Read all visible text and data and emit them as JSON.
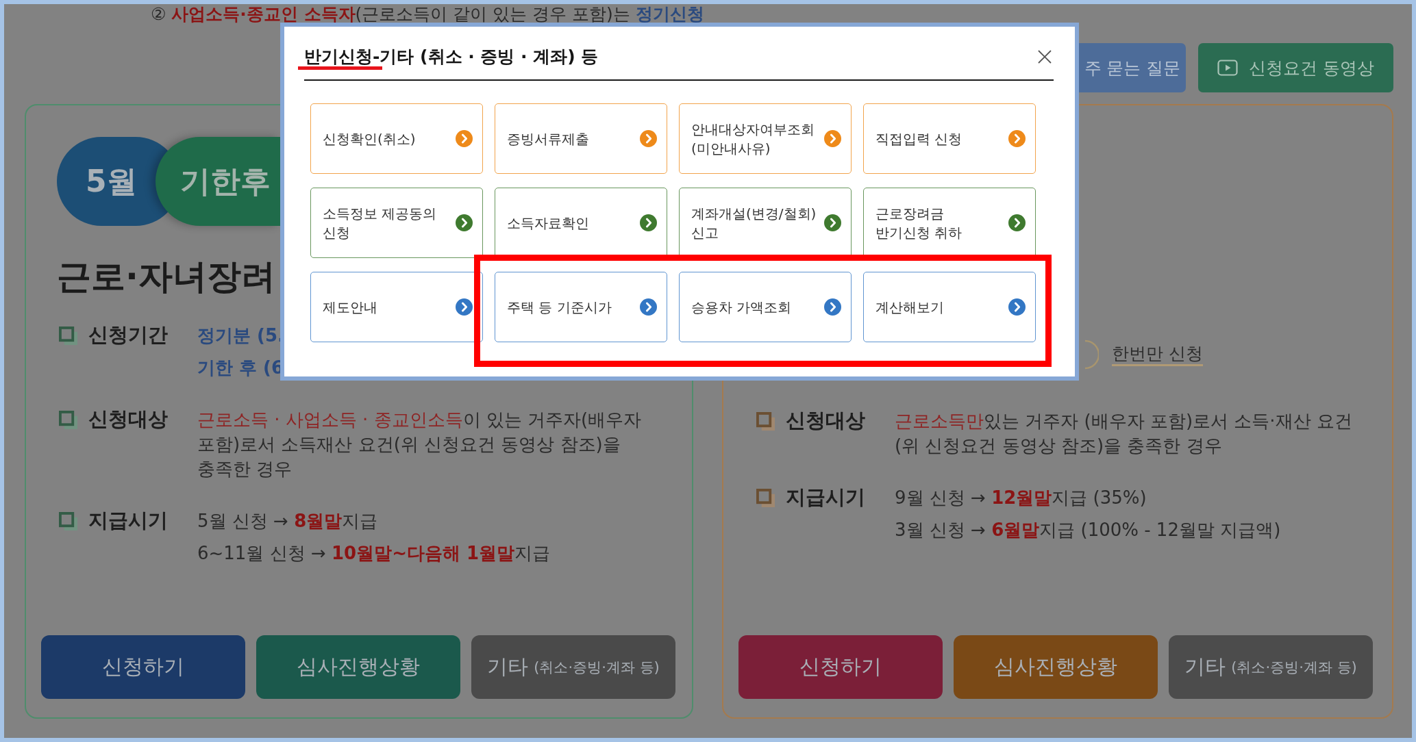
{
  "notice": {
    "segments": [
      {
        "text": "② ",
        "kind": "plain"
      },
      {
        "text": "사업소득·종교인 소득자",
        "kind": "strong"
      },
      {
        "text": "(근로소득이 같이 있는 경우 포함)는 ",
        "kind": "plain"
      },
      {
        "text": "정기신청",
        "kind": "accent"
      }
    ]
  },
  "top_buttons": [
    {
      "label": "주 묻는 질문",
      "kind": "plain",
      "color": "#4d6c99"
    },
    {
      "label": "신청요건 동영상",
      "kind": "video",
      "color": "#2b6c52"
    }
  ],
  "cards": [
    {
      "color": "#4f8d6c",
      "badges": [
        {
          "label": "5월",
          "color": "#1c4e75"
        },
        {
          "label": "기한후",
          "color": "#1f6b4a"
        }
      ],
      "heading": "근로·자녀장려",
      "rows": [
        {
          "label": "신청기간",
          "lines": [
            [
              {
                "text": "정기분 (5.",
                "kind": "accent"
              }
            ],
            [
              {
                "text": "기한 후 (6",
                "kind": "accent"
              }
            ]
          ]
        },
        {
          "label": "신청대상",
          "lines": [
            [
              {
                "text": "근로소득 · 사업소득 · 종교인소득",
                "kind": "emphasis"
              },
              {
                "text": "이 있는 거주자(배우자 포함)로서 소득재산 요건(위 신청요건 동영상 참조)을 충족한 경우",
                "kind": "plain"
              }
            ]
          ]
        },
        {
          "label": "지급시기",
          "lines": [
            [
              {
                "text": "5월 신청 → ",
                "kind": "plain"
              },
              {
                "text": "8월말",
                "kind": "strong"
              },
              {
                "text": "지급",
                "kind": "plain"
              }
            ],
            [
              {
                "text": "6~11월 신청 → ",
                "kind": "plain"
              },
              {
                "text": "10월말~다음해 1월말",
                "kind": "strong"
              },
              {
                "text": "지급",
                "kind": "plain"
              }
            ]
          ]
        }
      ],
      "buttons": [
        {
          "label": "신청하기",
          "color": "#1c3a68"
        },
        {
          "label": "심사진행상황",
          "color": "#1b594c"
        },
        {
          "label": "기타",
          "note": "(취소·증빙·계좌 등)",
          "color": "#4a4a4a"
        }
      ]
    },
    {
      "color": "#a57a4d",
      "link": "한번만 신청",
      "rows": [
        {
          "label": "신청대상",
          "lines": [
            [
              {
                "text": "근로소득만",
                "kind": "emphasis"
              },
              {
                "text": "있는 거주자 (배우자 포함)로서 소득·재산 요건 (위 신청요건 동영상 참조)을 충족한 경우",
                "kind": "plain"
              }
            ]
          ]
        },
        {
          "label": "지급시기",
          "lines": [
            [
              {
                "text": "9월 신청 → ",
                "kind": "plain"
              },
              {
                "text": "12월말",
                "kind": "strong"
              },
              {
                "text": "지급 (35%)",
                "kind": "plain"
              }
            ],
            [
              {
                "text": "3월 신청 → ",
                "kind": "plain"
              },
              {
                "text": "6월말",
                "kind": "strong"
              },
              {
                "text": "지급 (100% - 12월말 지급액)",
                "kind": "plain"
              }
            ]
          ]
        }
      ],
      "buttons": [
        {
          "label": "신청하기",
          "color": "#7b1f38"
        },
        {
          "label": "심사진행상황",
          "color": "#7a4916"
        },
        {
          "label": "기타",
          "note": "(취소·증빙·계좌 등)",
          "color": "#4c4c4c"
        }
      ]
    }
  ],
  "modal": {
    "title": [
      {
        "text": "반기신청",
        "marked": true
      },
      {
        "text": "-기타 (취소 · 증빙 · 계좌) 등",
        "marked": false
      }
    ],
    "rows": [
      {
        "color": "#ee8a1a",
        "groups": [
          {
            "framed": false,
            "buttons": [
              {
                "label": "신청확인(취소)"
              },
              {
                "label": "증빙서류제출"
              },
              {
                "label": "안내대상자여부조회\n(미안내사유)"
              },
              {
                "label": "직접입력 신청"
              }
            ]
          }
        ]
      },
      {
        "color": "#3f7a2f",
        "groups": [
          {
            "framed": false,
            "buttons": [
              {
                "label": "소득정보 제공동의\n신청"
              },
              {
                "label": "소득자료확인"
              },
              {
                "label": "계좌개설(변경/철회)\n신고"
              },
              {
                "label": "근로장려금\n반기신청 취하"
              }
            ]
          }
        ]
      },
      {
        "color": "#3377c4",
        "groups": [
          {
            "framed": false,
            "buttons": [
              {
                "label": "제도안내"
              }
            ]
          },
          {
            "framed": true,
            "buttons": [
              {
                "label": "주택 등 기준시가"
              },
              {
                "label": "승용차 가액조회"
              },
              {
                "label": "계산해보기"
              }
            ]
          }
        ]
      }
    ]
  }
}
